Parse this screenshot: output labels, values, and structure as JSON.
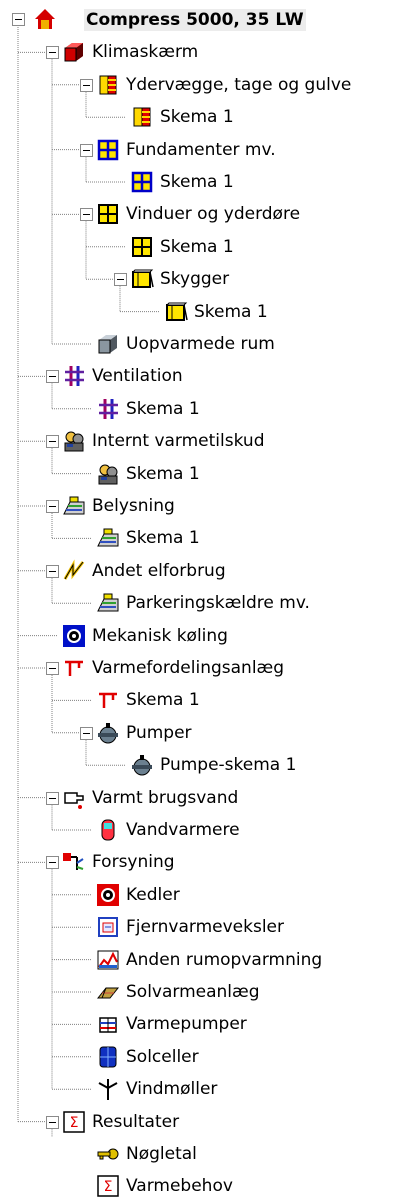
{
  "tree": {
    "root_label": "Compress 5000, 35 LW",
    "nodes": [
      {
        "label": "Klimaskærm",
        "icon": "cube-icon"
      },
      {
        "label": "Ydervægge, tage og gulve",
        "icon": "wall-icon"
      },
      {
        "label": "Skema 1",
        "icon": "wall-icon"
      },
      {
        "label": "Fundamenter mv.",
        "icon": "window-grid-blue-icon"
      },
      {
        "label": "Skema 1",
        "icon": "window-grid-blue-icon"
      },
      {
        "label": "Vinduer og yderdøre",
        "icon": "window-grid-yellow-icon"
      },
      {
        "label": "Skema 1",
        "icon": "window-grid-yellow-icon"
      },
      {
        "label": "Skygger",
        "icon": "shade-icon"
      },
      {
        "label": "Skema 1",
        "icon": "shade-icon"
      },
      {
        "label": "Uopvarmede rum",
        "icon": "gray-cube-icon"
      },
      {
        "label": "Ventilation",
        "icon": "ventilation-icon"
      },
      {
        "label": "Skema 1",
        "icon": "ventilation-icon"
      },
      {
        "label": "Internt varmetilskud",
        "icon": "people-icon"
      },
      {
        "label": "Skema 1",
        "icon": "people-icon"
      },
      {
        "label": "Belysning",
        "icon": "lamp-icon"
      },
      {
        "label": "Skema 1",
        "icon": "lamp-icon"
      },
      {
        "label": "Andet elforbrug",
        "icon": "electric-icon"
      },
      {
        "label": "Parkeringskældre mv.",
        "icon": "lamp-icon"
      },
      {
        "label": "Mekanisk køling",
        "icon": "cooling-icon"
      },
      {
        "label": "Varmefordelingsanlæg",
        "icon": "distribution-icon"
      },
      {
        "label": "Skema 1",
        "icon": "distribution-icon"
      },
      {
        "label": "Pumper",
        "icon": "pump-icon"
      },
      {
        "label": "Pumpe-skema 1",
        "icon": "pump-icon"
      },
      {
        "label": "Varmt brugsvand",
        "icon": "tap-icon"
      },
      {
        "label": "Vandvarmere",
        "icon": "water-heater-icon"
      },
      {
        "label": "Forsyning",
        "icon": "supply-icon"
      },
      {
        "label": "Kedler",
        "icon": "boiler-icon"
      },
      {
        "label": "Fjernvarmeveksler",
        "icon": "exchanger-icon"
      },
      {
        "label": "Anden rumopvarmning",
        "icon": "chart-icon"
      },
      {
        "label": "Solvarmeanlæg",
        "icon": "solar-collector-icon"
      },
      {
        "label": "Varmepumper",
        "icon": "heat-pump-icon"
      },
      {
        "label": "Solceller",
        "icon": "solar-cell-icon"
      },
      {
        "label": "Vindmøller",
        "icon": "wind-turbine-icon"
      },
      {
        "label": "Resultater",
        "icon": "sum-icon"
      },
      {
        "label": "Nøgletal",
        "icon": "key-icon"
      },
      {
        "label": "Varmebehov",
        "icon": "sum-icon"
      }
    ]
  },
  "colors": {
    "line": "#808080",
    "roof": "#d40000",
    "house": "#f0b000"
  }
}
